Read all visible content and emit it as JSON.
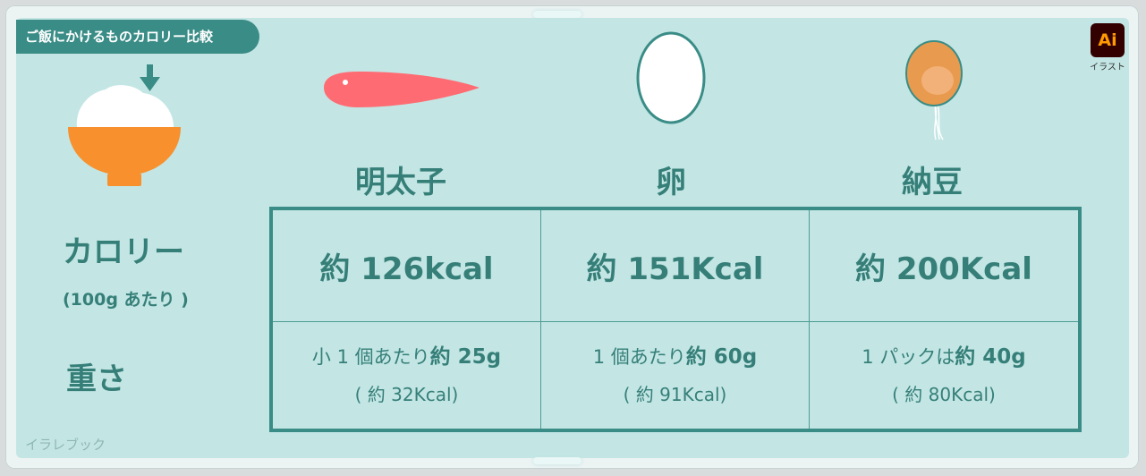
{
  "title": "ご飯にかけるものカロリー比較",
  "app_badge": {
    "text": "Ai",
    "caption": "イラスト"
  },
  "watermark": "イラレブック",
  "row_labels": {
    "calorie": "カロリー",
    "calorie_note": "(100g あたり )",
    "weight": "重さ"
  },
  "foods": [
    {
      "name": "明太子",
      "calories": "約 126kcal",
      "weight_prefix": "小 1 個あたり",
      "weight_value": "約 25g",
      "weight_cal": "( 約 32Kcal)"
    },
    {
      "name": "卵",
      "calories": "約 151Kcal",
      "weight_prefix": "1 個あたり",
      "weight_value": "約 60g",
      "weight_cal": "( 約 91Kcal)"
    },
    {
      "name": "納豆",
      "calories": "約 200Kcal",
      "weight_prefix": "1 パックは",
      "weight_value": "約 40g",
      "weight_cal": "( 約 80Kcal)"
    }
  ],
  "colors": {
    "accent": "#3a8c86",
    "text": "#367f79",
    "panel": "#c3e6e4",
    "bowl": "#f7902d",
    "mentaiko": "#ff6b72",
    "natto": "#f0a050"
  }
}
